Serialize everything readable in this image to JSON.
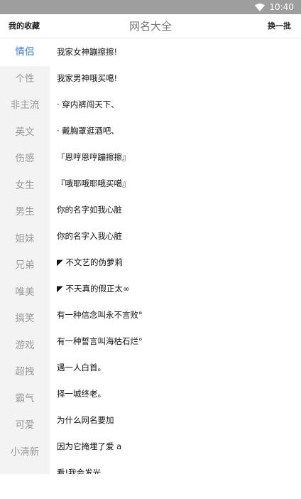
{
  "status_bar": {
    "time": "10:40",
    "icons": [
      "wifi-icon"
    ]
  },
  "header": {
    "left_label": "我的收藏",
    "title": "网名大全",
    "right_label": "换一批"
  },
  "sidebar": {
    "active_index": 0,
    "items": [
      {
        "label": "情侣"
      },
      {
        "label": "个性"
      },
      {
        "label": "非主流"
      },
      {
        "label": "英文"
      },
      {
        "label": "伤感"
      },
      {
        "label": "女生"
      },
      {
        "label": "男生"
      },
      {
        "label": "姐妹"
      },
      {
        "label": "兄弟"
      },
      {
        "label": "唯美"
      },
      {
        "label": "搞笑"
      },
      {
        "label": "游戏"
      },
      {
        "label": "超拽"
      },
      {
        "label": "霸气"
      },
      {
        "label": "可爱"
      },
      {
        "label": "小清新"
      }
    ]
  },
  "names": [
    "我家女神蹦擦擦!",
    "我家男神哦买噶!",
    "· 穿内裤闯天下、",
    "· 戴胸罩逛酒吧、",
    "『恩哼恩哼蹦擦擦』",
    "『哦耶哦耶哦买噶』",
    "你的名字如我心脏",
    "你的名字入我心脏",
    "◤ 不文艺的伪萝莉",
    "◤ 不天真的假正太∞",
    "有一种信念叫永不言败°",
    "有一种誓言叫海枯石烂°",
    "遇一人白首。",
    "择一城终老。",
    "为什么网名要加",
    "因为它掩埋了爱 a",
    "看!我会发光"
  ],
  "colors": {
    "status_bar": "#9e9e9e",
    "sidebar_bg": "#f3f3f3",
    "active_text": "#3a7bd5",
    "inactive_text": "#9a9a9a"
  }
}
